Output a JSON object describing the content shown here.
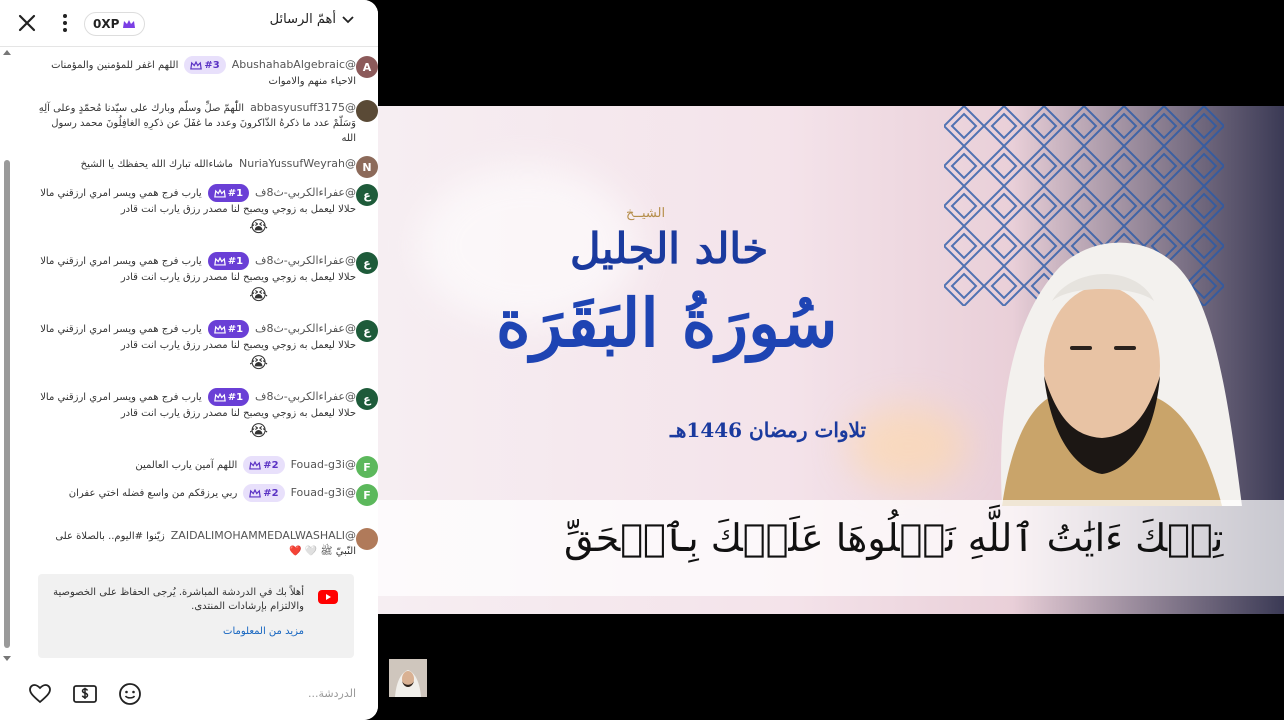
{
  "header": {
    "xp": "0XP",
    "title": "أهمّ الرسائل"
  },
  "messages": [
    {
      "avatar_letter": "A",
      "avatar_color": "#8c5a5a",
      "author": "@AbushahabAlgebraic",
      "badge": "#3",
      "text": "اللهم اغفر للمؤمنين والمؤمنات الاحياء منهم والاموات"
    },
    {
      "avatar_letter": "",
      "avatar_color": "#5a4a36",
      "author": "@abbasyusuff3175",
      "badge": "",
      "text": "اللّٰهمّ صلِّ وسلّم وبارك على سيّدنا مُحمّدٍ وعلى آلِهِ وَسَلّمْ عدد ما ذكرهُ الذّاكرونَ وعدد ما غفَلَ عن ذكرِهِ الغافِلُونَ محمد رسول الله"
    },
    {
      "avatar_letter": "N",
      "avatar_color": "#8c6a5a",
      "author": "@NuriaYussufWeyrah",
      "badge": "",
      "text": "ماشاءالله تبارك الله يحفظك يا الشيخ"
    },
    {
      "avatar_letter": "ع",
      "avatar_color": "#1e5b3a",
      "author": "@عفراءالكربي-ث8ف",
      "badge": "#1",
      "text": "يارب فرج همي ويسر امري ارزقني مالا حلالا ليعمل به زوجي ويصبح لنا مصدر رزق يارب انت قادر",
      "emoji": "😭"
    },
    {
      "avatar_letter": "ع",
      "avatar_color": "#1e5b3a",
      "author": "@عفراءالكربي-ث8ف",
      "badge": "#1",
      "text": "يارب فرج همي ويسر امري ارزقني مالا حلالا ليعمل به زوجي ويصبح لنا مصدر رزق يارب انت قادر",
      "emoji": "😭"
    },
    {
      "avatar_letter": "ع",
      "avatar_color": "#1e5b3a",
      "author": "@عفراءالكربي-ث8ف",
      "badge": "#1",
      "text": "يارب فرج همي ويسر امري ارزقني مالا حلالا ليعمل به زوجي ويصبح لنا مصدر رزق يارب انت قادر",
      "emoji": "😭"
    },
    {
      "avatar_letter": "ع",
      "avatar_color": "#1e5b3a",
      "author": "@عفراءالكربي-ث8ف",
      "badge": "#1",
      "text": "يارب فرج همي ويسر امري ارزقني مالا حلالا ليعمل به زوجي ويصبح لنا مصدر رزق يارب انت قادر",
      "emoji": "😭"
    },
    {
      "avatar_letter": "F",
      "avatar_color": "#5cb85c",
      "author": "@Fouad-g3i",
      "badge": "#2",
      "text": "اللهم آمين يارب العالمين"
    },
    {
      "avatar_letter": "F",
      "avatar_color": "#5cb85c",
      "author": "@Fouad-g3i",
      "badge": "#2",
      "text": "ربي يرزقكم من واسع فضله اختي عفران"
    },
    {
      "avatar_letter": "",
      "avatar_color": "#b07a5a",
      "author": "@ZAIDALIMOHAMMEDALWASHALI",
      "badge": "",
      "text": "زيّنوا #اليوم.. بالصلاة على النّبيّ ﷺ 🤍 ❤️"
    }
  ],
  "notice": {
    "text": "أهلاً بك في الدردشة المباشرة. يُرجى الحفاظ على الخصوصية والالتزام بإرشادات المنتدى.",
    "link": "مزيد من المعلومات"
  },
  "footer": {
    "placeholder": "الدردشة..."
  },
  "video": {
    "sheikh_label": "الشيــخ",
    "name": "خالد الجليل",
    "surah": "سُورَةُ البَقَرَة",
    "recitation": "تلاوات رمضان 1446هـ",
    "verse": "تِلۡكَ ءَايَٰتُ ٱللَّهِ نَتۡلُوهَا عَلَيۡكَ بِٱلۡحَقِّ"
  },
  "colors": {
    "badge_first": "#6a3fd6",
    "badge_other": "#e8e0fb",
    "title_blue": "#1e44b3",
    "link": "#1565c0"
  }
}
